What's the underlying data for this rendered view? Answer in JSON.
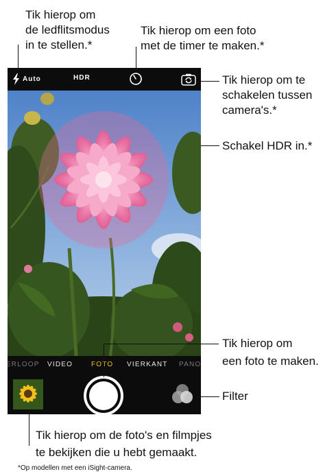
{
  "callouts": {
    "flash": [
      "Tik hierop om",
      "de ledflitsmodus",
      "in te stellen.*"
    ],
    "timer": [
      "Tik hierop om een foto",
      "met de timer te maken.*"
    ],
    "switch_camera": [
      "Tik hierop om te",
      "schakelen tussen",
      "camera's.*"
    ],
    "hdr": "Schakel HDR in.*",
    "shutter": [
      "Tik hierop om",
      "een foto te maken."
    ],
    "filter": "Filter",
    "gallery": [
      "Tik hierop om de foto's en filmpjes",
      "te bekijken die u hebt gemaakt."
    ]
  },
  "camera": {
    "flash_label": "Auto",
    "hdr_label": "HDR",
    "modes": [
      "TIJDVERLOOP",
      "VIDEO",
      "FOTO",
      "VIERKANT",
      "PANORAMA"
    ],
    "active_mode": "FOTO"
  },
  "footnote": "*Op modellen met een iSight-camera.",
  "colors": {
    "active_mode": "#f5c518",
    "bar": "#0c0c0c",
    "sky": "#5f8fd0",
    "petal": "#f28ab2"
  }
}
